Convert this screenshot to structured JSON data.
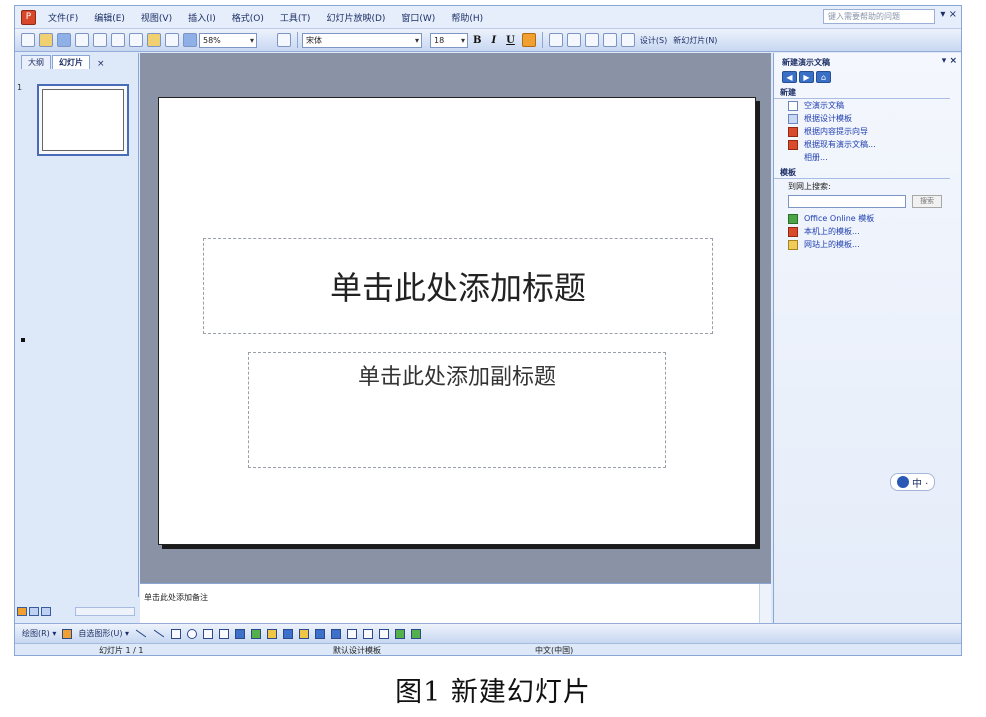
{
  "menu": {
    "items": [
      "文件(F)",
      "编辑(E)",
      "视图(V)",
      "插入(I)",
      "格式(O)",
      "工具(T)",
      "幻灯片放映(D)",
      "窗口(W)",
      "帮助(H)"
    ],
    "help_placeholder": "键入需要帮助的问题",
    "close": "▾ ×"
  },
  "toolbar": {
    "zoom": "58%",
    "font_name": "宋体",
    "font_size": "18",
    "bold": "B",
    "italic": "I",
    "underline": "U",
    "design_label": "设计(S)",
    "new_slide_label": "新幻灯片(N)"
  },
  "tabs": {
    "outline": "大纲",
    "slides": "幻灯片",
    "close": "×"
  },
  "slide_panel": {
    "slide_number": "1"
  },
  "slide": {
    "title_placeholder": "单击此处添加标题",
    "subtitle_placeholder": "单击此处添加副标题"
  },
  "notes": {
    "placeholder": "单击此处添加备注"
  },
  "task_pane": {
    "title": "新建演示文稿",
    "controls": "▾ ×",
    "nav": [
      "◀",
      "▶",
      "⌂"
    ],
    "section_new": "新建",
    "new_links": [
      "空演示文稿",
      "根据设计模板",
      "根据内容提示向导",
      "根据现有演示文稿...",
      "相册..."
    ],
    "section_templates": "模板",
    "search_label": "到网上搜索:",
    "search_button": "搜索",
    "template_links": [
      "Office Online 模板",
      "本机上的模板...",
      "网站上的模板..."
    ]
  },
  "ime": {
    "text": "中 ·"
  },
  "drawing_toolbar": {
    "draw_label": "绘图(R) ▾",
    "autoshapes_label": "自选图形(U) ▾"
  },
  "status_bar": {
    "slide_info": "幻灯片 1 / 1",
    "design": "默认设计模板",
    "language": "中文(中国)"
  },
  "caption": "图1  新建幻灯片"
}
